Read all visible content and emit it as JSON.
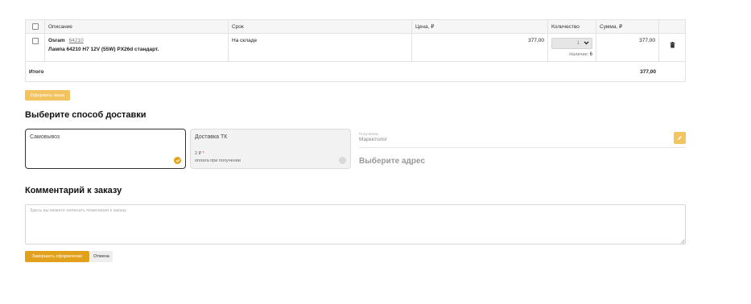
{
  "cart": {
    "columns": {
      "description": "Описание",
      "term": "Срок",
      "price": "Цена, ₽",
      "quantity": "Количество",
      "sum": "Сумма, ₽"
    },
    "items": [
      {
        "brand": "Osram",
        "code": "64210",
        "name": "Лампа 64210 H7 12V (55W) PX26d стандарт.",
        "term": "На складе",
        "price": "377,00",
        "quantity": "1",
        "stock_label": "Наличие:",
        "stock_value": "6",
        "sum": "377,00"
      }
    ],
    "total_label": "Итого",
    "total_value": "377,00"
  },
  "order_button": "Оформить заказ",
  "delivery": {
    "heading": "Выберите способ доставки",
    "options": [
      {
        "title": "Самовывоз",
        "selected": true
      },
      {
        "title": "Доставка ТК",
        "price": "2 ₽",
        "price_mark": "*",
        "note": "оплата при получении",
        "selected": false
      }
    ],
    "recipient_label": "Получатель",
    "recipient_value": "Маркетолог",
    "address_prompt": "Выберите адрес"
  },
  "comment": {
    "heading": "Комментарий к заказу",
    "placeholder": "Здесь вы можете написать пожелания к заказу"
  },
  "actions": {
    "finish": "Завершить оформление",
    "cancel": "Отмена"
  },
  "colors": {
    "accent": "#e2a11c",
    "accent_light": "#f3c35f"
  },
  "icons": {
    "delete": "trash-icon",
    "edit": "pencil-icon",
    "selected": "check-circle-icon",
    "dropdown": "chevron-down-icon"
  }
}
